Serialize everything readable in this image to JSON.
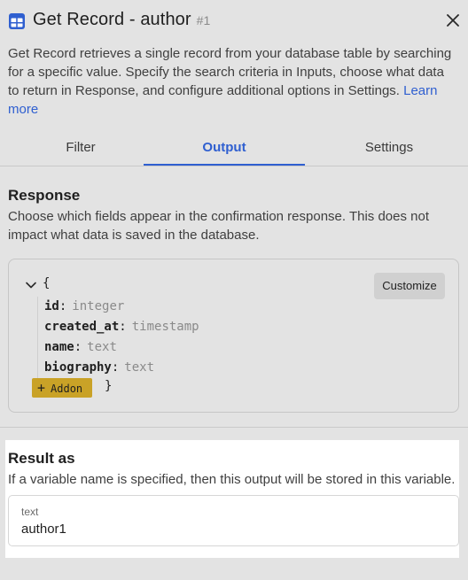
{
  "header": {
    "title": "Get Record - author",
    "record_id": "#1",
    "icon": "table-icon",
    "close_icon": "close-icon"
  },
  "description": {
    "text": "Get Record retrieves a single record from your database table by searching for a specific value. Specify the search criteria in Inputs, choose what data to return in Response, and configure additional options in Settings.",
    "link_text": "Learn more"
  },
  "tabs": [
    {
      "label": "Filter",
      "active": false
    },
    {
      "label": "Output",
      "active": true
    },
    {
      "label": "Settings",
      "active": false
    }
  ],
  "response": {
    "title": "Response",
    "description": "Choose which fields appear in the confirmation response. This does not impact what data is saved in the database.",
    "open_brace": "{",
    "close_brace": "}",
    "customize_label": "Customize",
    "addon_label": "Addon",
    "fields": [
      {
        "name": "id",
        "type": "integer"
      },
      {
        "name": "created_at",
        "type": "timestamp"
      },
      {
        "name": "name",
        "type": "text"
      },
      {
        "name": "biography",
        "type": "text"
      }
    ]
  },
  "result": {
    "title": "Result as",
    "description": "If a variable name is specified, then this output will be stored in this variable.",
    "input_label": "text",
    "input_value": "author1"
  },
  "colors": {
    "accent": "#2f5fd0",
    "addon": "#c9a227",
    "background": "#e3e3e3"
  }
}
